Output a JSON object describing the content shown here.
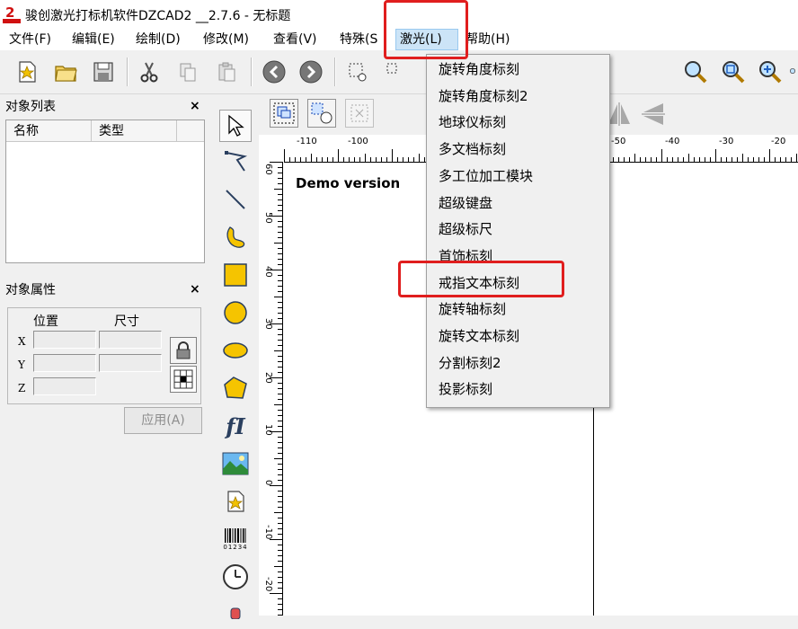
{
  "window": {
    "title": "骏创激光打标机软件DZCAD2 __2.7.6 - 无标题"
  },
  "menubar": {
    "items": [
      {
        "label": "文件(F)"
      },
      {
        "label": "编辑(E)"
      },
      {
        "label": "绘制(D)"
      },
      {
        "label": "修改(M)"
      },
      {
        "label": "查看(V)"
      },
      {
        "label": "特殊(S"
      },
      {
        "label": "激光(L)"
      },
      {
        "label": "帮助(H)"
      }
    ]
  },
  "laser_menu": {
    "items": [
      {
        "label": "旋转角度标刻"
      },
      {
        "label": "旋转角度标刻2"
      },
      {
        "label": "地球仪标刻"
      },
      {
        "label": "多文档标刻"
      },
      {
        "label": "多工位加工模块"
      },
      {
        "label": "超级键盘"
      },
      {
        "label": "超级标尺"
      },
      {
        "label": "首饰标刻"
      },
      {
        "label": "戒指文本标刻"
      },
      {
        "label": "旋转轴标刻"
      },
      {
        "label": "旋转文本标刻"
      },
      {
        "label": "分割标刻2"
      },
      {
        "label": "投影标刻"
      }
    ]
  },
  "object_list": {
    "title": "对象列表",
    "close": "×",
    "columns": [
      "名称",
      "类型"
    ]
  },
  "object_props": {
    "title": "对象属性",
    "close": "×",
    "position_label": "位置",
    "size_label": "尺寸",
    "axis_x": "X",
    "axis_y": "Y",
    "axis_z": "Z",
    "apply_label": "应用(A)"
  },
  "canvas": {
    "demo_text": "Demo version",
    "ruler_top_labels": [
      "-110",
      "-100",
      "-50",
      "-40",
      "-30",
      "-20"
    ],
    "ruler_left_labels": [
      "60",
      "50",
      "40",
      "30",
      "20",
      "10",
      "0",
      "-10",
      "-20"
    ]
  },
  "draw_tools": {
    "text_tool_label": "fI",
    "barcode_label": "01234"
  },
  "colors": {
    "highlight_red": "#e01e1e",
    "shape_fill": "#f5c400",
    "menu_active_bg": "#cce4f7"
  }
}
